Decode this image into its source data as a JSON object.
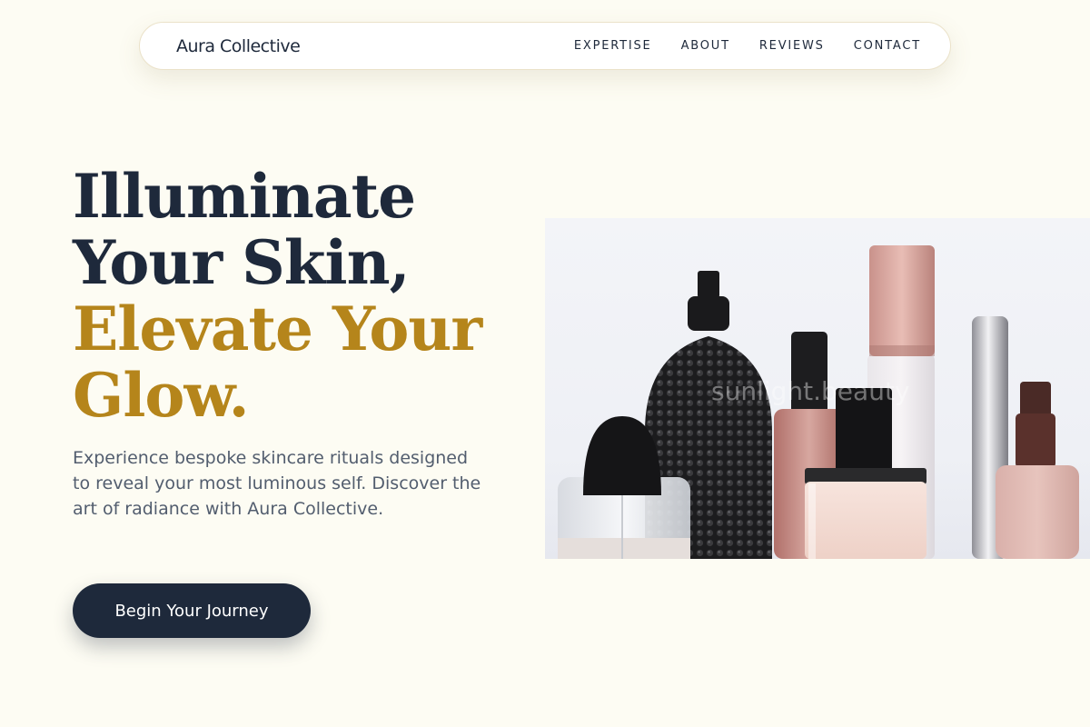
{
  "nav": {
    "brand": "Aura Collective",
    "links": [
      {
        "label": "EXPERTISE"
      },
      {
        "label": "ABOUT"
      },
      {
        "label": "REVIEWS"
      },
      {
        "label": "CONTACT"
      }
    ]
  },
  "hero": {
    "title_line1": "Illuminate",
    "title_line2": "Your Skin,",
    "title_line3": "Elevate Your",
    "title_line4": "Glow.",
    "description": "Experience bespoke skincare rituals designed to reveal your most luminous self. Discover the art of radiance with Aura Collective.",
    "cta_label": "Begin Your Journey",
    "image": {
      "subject": "perfume-and-cosmetic-bottles",
      "watermark": "sunlight.beauty"
    }
  },
  "colors": {
    "page_bg": "#fdfcf3",
    "navy": "#1e293b",
    "gold": "#b5851b",
    "body_text": "#525d6e"
  }
}
